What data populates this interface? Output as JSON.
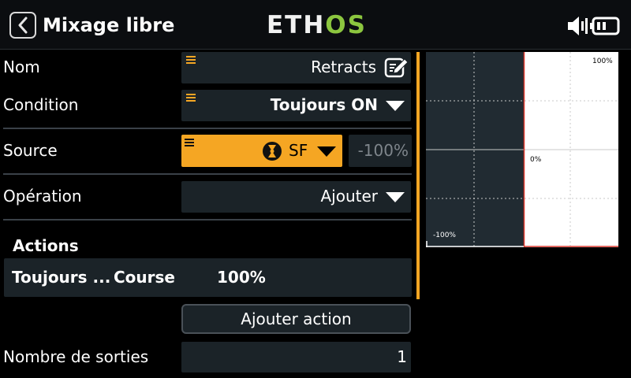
{
  "header": {
    "title": "Mixage libre",
    "logo_main": "ETH",
    "logo_accent": "OS",
    "back_icon": "chevron-left-icon",
    "audio_icon": "speaker-icon",
    "battery_icon": "battery-icon"
  },
  "form": {
    "name": {
      "label": "Nom",
      "value": "Retracts",
      "icon": "edit-icon"
    },
    "condition": {
      "label": "Condition",
      "value": "Toujours ON"
    },
    "source": {
      "label": "Source",
      "value": "SF",
      "weight": "-100%",
      "icon": "switch-icon"
    },
    "operation": {
      "label": "Opération",
      "value": "Ajouter"
    }
  },
  "actions": {
    "heading": "Actions",
    "rows": [
      {
        "condition": "Toujours ...",
        "type": "Course",
        "value": "100%"
      }
    ],
    "add_button": "Ajouter action"
  },
  "outputs": {
    "label": "Nombre de sorties",
    "value": "1"
  },
  "curve": {
    "top_label": "100%",
    "mid_label": "0%",
    "bottom_label": "-100%"
  },
  "colors": {
    "accent": "#f5a623",
    "field_bg": "#1b2328",
    "logo_green": "#8cc63f",
    "grid_line": "#c8c8c8",
    "axis_red": "#d9372b"
  }
}
